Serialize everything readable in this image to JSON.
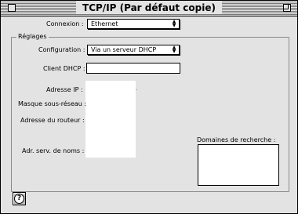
{
  "window": {
    "title": "TCP/IP (Par défaut copie)"
  },
  "connexion": {
    "label": "Connexion :",
    "value": "Ethernet"
  },
  "reglages": {
    "group_label": "Réglages",
    "configuration_label": "Configuration :",
    "configuration_value": "Via un serveur DHCP",
    "client_dhcp_label": "Client DHCP :",
    "client_dhcp_value": "",
    "adresse_ip_label": "Adresse IP :",
    "masque_label": "Masque sous-réseau :",
    "routeur_label": "Adresse du routeur :",
    "noms_label": "Adr. serv. de noms :",
    "domaines_label": "Domaines de recherche :"
  },
  "icons": {
    "popup_arrows": "up-down-arrows-icon",
    "help": "question-mark-icon"
  }
}
